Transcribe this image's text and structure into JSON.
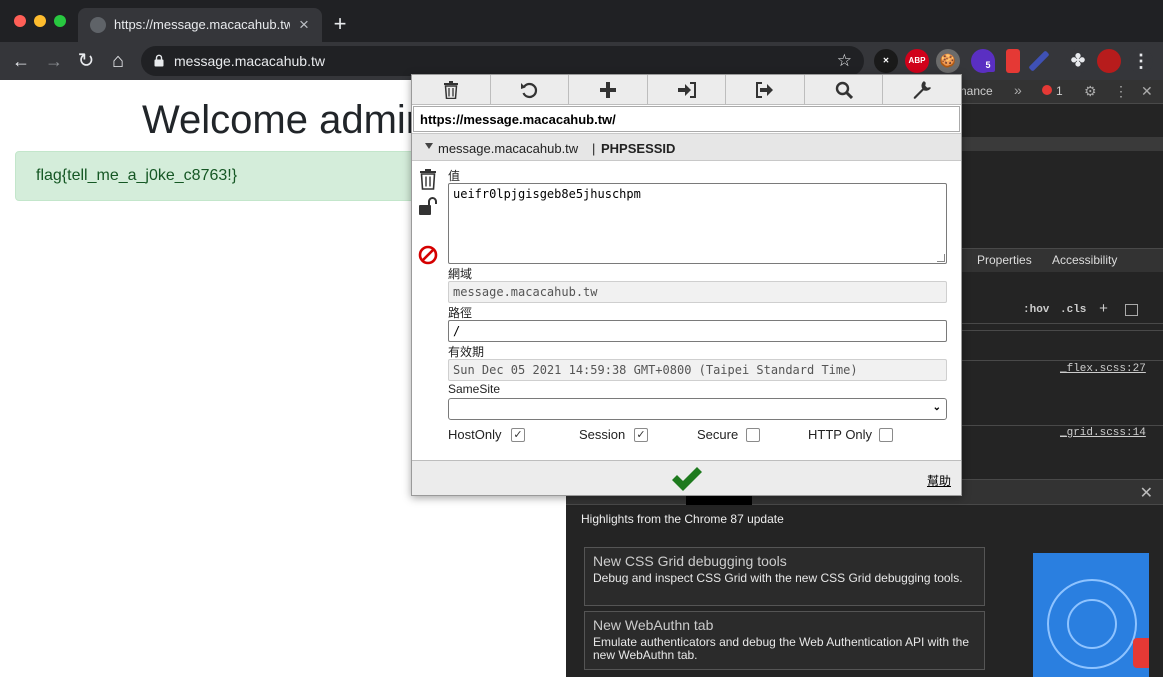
{
  "browser": {
    "tab_title": "https://message.macacahub.tw",
    "tab_close": "×",
    "new_tab": "+",
    "url": "message.macacahub.tw",
    "back": "←",
    "forward": "→",
    "reload": "↻",
    "home": "⌂",
    "star": "☆",
    "extensions": [
      {
        "icon": "x-extension-icon",
        "label": "✕",
        "color": "#1a1a1a"
      },
      {
        "icon": "adblock-plus-icon",
        "label": "ABP",
        "color": "#d0021b"
      },
      {
        "icon": "cookie-icon",
        "label": "🍪",
        "color": "#6b6b6b"
      },
      {
        "icon": "badge-extension-icon",
        "label": "5",
        "color": "#5a2fc2"
      },
      {
        "icon": "fire-extinguisher-icon",
        "label": "",
        "color": "#e53935"
      },
      {
        "icon": "pen-icon",
        "label": "",
        "color": "#3f51b5"
      },
      {
        "icon": "puzzle-icon",
        "label": "✤",
        "color": "#35363a"
      },
      {
        "icon": "avatar-icon",
        "label": "",
        "color": "#b71c1c"
      },
      {
        "icon": "kebab-menu-icon",
        "label": "⋮",
        "color": "#35363a"
      }
    ]
  },
  "page": {
    "title": "Welcome admin",
    "flag": "flag{tell_me_a_j0ke_c8763!}"
  },
  "devtools": {
    "tab_fragment": "nance",
    "more": "»",
    "error_count": "1",
    "settings": "⚙",
    "menu": "⋮",
    "close": "✕",
    "tabs": [
      "Properties",
      "Accessibility"
    ],
    "hov": ":hov",
    "cls": ".cls",
    "plus": "+",
    "rule_links": [
      "_flex.scss:27",
      "_grid.scss:14"
    ],
    "drawer": {
      "close": "✕",
      "heading": "Highlights from the Chrome 87 update",
      "cards": [
        {
          "title": "New CSS Grid debugging tools",
          "desc": "Debug and inspect CSS Grid with the new CSS Grid debugging tools."
        },
        {
          "title": "New WebAuthn tab",
          "desc": "Emulate authenticators and debug the Web Authentication API with the new WebAuthn tab."
        }
      ]
    }
  },
  "cookie_editor": {
    "toolbar": [
      "trash-icon",
      "undo-icon",
      "plus-icon",
      "import-icon",
      "export-icon",
      "search-icon",
      "wrench-icon"
    ],
    "url": "https://message.macacahub.tw/",
    "domain": "message.macacahub.tw",
    "separator": "|",
    "cookie_name": "PHPSESSID",
    "labels": {
      "value": "值",
      "domain": "網域",
      "path": "路徑",
      "expires": "有效期",
      "samesite": "SameSite"
    },
    "value": "ueifr0lpjgisgeb8e5jhuschpm",
    "domain_value": "message.macacahub.tw",
    "path_value": "/",
    "expires_value": "Sun Dec 05 2021 14:59:38 GMT+0800 (Taipei Standard Time)",
    "samesite_value": "",
    "flags": [
      {
        "label": "HostOnly",
        "checked": true,
        "mark": "✓"
      },
      {
        "label": "Session",
        "checked": true,
        "mark": "✓"
      },
      {
        "label": "Secure",
        "checked": false,
        "mark": ""
      },
      {
        "label": "HTTP Only",
        "checked": false,
        "mark": ""
      }
    ],
    "help": "幫助",
    "select_arrow": "⌄",
    "colors": {
      "save_check": "#1e7a1e",
      "block_icon": "#d50000"
    }
  }
}
